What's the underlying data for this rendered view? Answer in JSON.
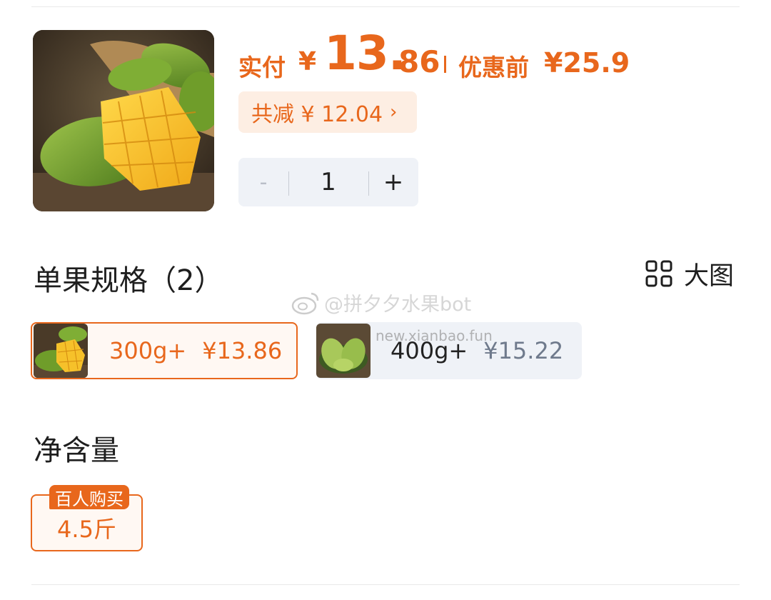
{
  "colors": {
    "accent": "#e8671c",
    "accent_bg": "#fdeee3",
    "neutral_bg": "#eff2f7"
  },
  "product": {
    "image_icon": "mango-photo"
  },
  "price": {
    "pay_label": "实付",
    "pay_currency": "¥",
    "pay_integer": "13.",
    "pay_decimal": "86",
    "original_label": "优惠前",
    "original_price": "¥25.9"
  },
  "discount": {
    "text": "共减 ¥ 12.04",
    "chevron": "›"
  },
  "quantity": {
    "minus": "-",
    "value": "1",
    "plus": "+"
  },
  "spec": {
    "title": "单果规格（2）",
    "big_picture_label": "大图",
    "big_picture_icon": "grid-icon",
    "options": [
      {
        "weight": "300g+",
        "price": "¥13.86",
        "selected": true
      },
      {
        "weight": "400g+",
        "price": "¥15.22",
        "selected": false
      }
    ]
  },
  "watermark": {
    "text": "@拼夕夕水果bot",
    "url": "new.xianbao.fun"
  },
  "net_content": {
    "title": "净含量",
    "options": [
      {
        "badge": "百人购买",
        "value": "4.5斤",
        "selected": true
      }
    ]
  }
}
